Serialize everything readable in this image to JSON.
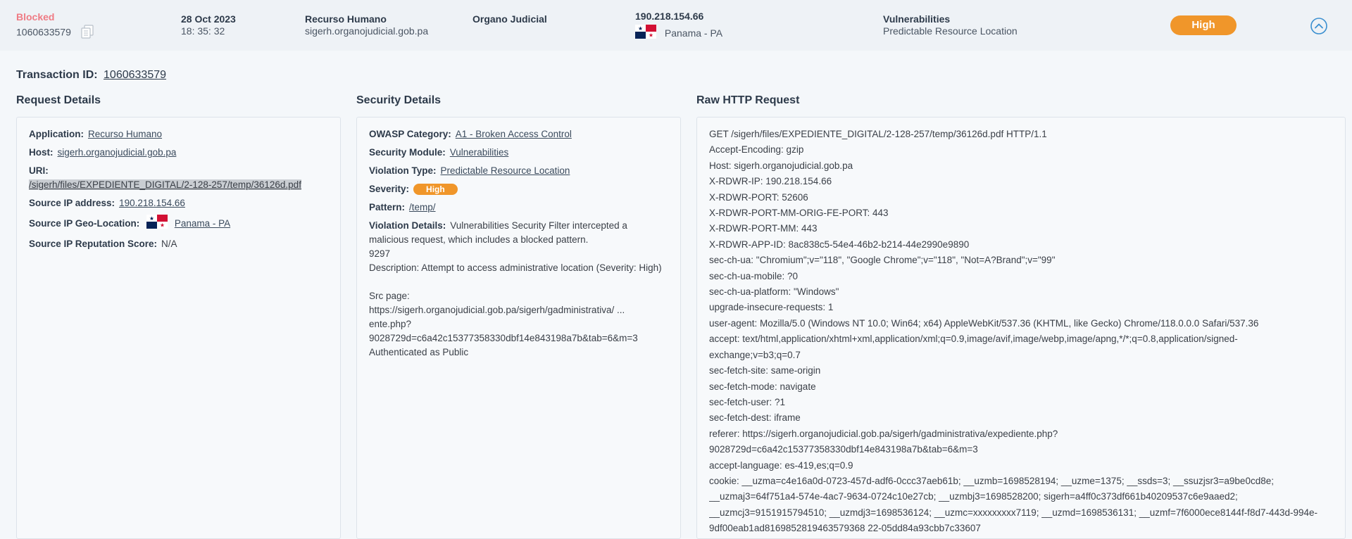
{
  "summary": {
    "status": "Blocked",
    "transaction_id": "1060633579",
    "date": "28 Oct 2023",
    "time": "18: 35: 32",
    "app_name": "Recurso Humano",
    "app_host": "sigerh.organojudicial.gob.pa",
    "organization": "Organo Judicial",
    "ip": "190.218.154.66",
    "geo": "Panama - PA",
    "module": "Vulnerabilities",
    "violation": "Predictable Resource Location",
    "severity": "High"
  },
  "transaction": {
    "label": "Transaction ID:",
    "id": "1060633579"
  },
  "request_details": {
    "title": "Request Details",
    "application_label": "Application:",
    "application": "Recurso Humano",
    "host_label": "Host:",
    "host": "sigerh.organojudicial.gob.pa",
    "uri_label": "URI:",
    "uri": "/sigerh/files/EXPEDIENTE_DIGITAL/2-128-257/temp/36126d.pdf",
    "source_ip_label": "Source IP address:",
    "source_ip": "190.218.154.66",
    "geo_label": "Source IP Geo-Location:",
    "geo": "Panama - PA",
    "reputation_label": "Source IP Reputation Score:",
    "reputation": "N/A"
  },
  "security_details": {
    "title": "Security Details",
    "owasp_label": "OWASP Category:",
    "owasp": "A1 - Broken Access Control",
    "module_label": "Security Module:",
    "module": "Vulnerabilities",
    "violation_label": "Violation Type:",
    "violation": "Predictable Resource Location",
    "severity_label": "Severity:",
    "severity": "High",
    "pattern_label": "Pattern:",
    "pattern": "/temp/",
    "details_label": "Violation Details:",
    "details_first": "Vulnerabilities Security Filter intercepted a malicious request, which includes a blocked pattern.",
    "details_rest": "9297\nDescription: Attempt to access administrative location (Severity: High)\n\nSrc page:\nhttps://sigerh.organojudicial.gob.pa/sigerh/gadministrativa/ ...\nente.php?\n9028729d=c6a42c15377358330dbf14e843198a7b&tab=6&m=3\nAuthenticated as Public"
  },
  "raw_http": {
    "title": "Raw HTTP Request",
    "lines": [
      "GET /sigerh/files/EXPEDIENTE_DIGITAL/2-128-257/temp/36126d.pdf HTTP/1.1",
      "Accept-Encoding: gzip",
      "Host: sigerh.organojudicial.gob.pa",
      "X-RDWR-IP: 190.218.154.66",
      "X-RDWR-PORT: 52606",
      "X-RDWR-PORT-MM-ORIG-FE-PORT: 443",
      "X-RDWR-PORT-MM: 443",
      "X-RDWR-APP-ID: 8ac838c5-54e4-46b2-b214-44e2990e9890",
      "sec-ch-ua: \"Chromium\";v=\"118\", \"Google Chrome\";v=\"118\", \"Not=A?Brand\";v=\"99\"",
      "sec-ch-ua-mobile: ?0",
      "sec-ch-ua-platform: \"Windows\"",
      "upgrade-insecure-requests: 1",
      "user-agent: Mozilla/5.0 (Windows NT 10.0; Win64; x64) AppleWebKit/537.36 (KHTML, like Gecko) Chrome/118.0.0.0 Safari/537.36",
      "accept: text/html,application/xhtml+xml,application/xml;q=0.9,image/avif,image/webp,image/apng,*/*;q=0.8,application/signed-",
      "exchange;v=b3;q=0.7",
      "sec-fetch-site: same-origin",
      "sec-fetch-mode: navigate",
      "sec-fetch-user: ?1",
      "sec-fetch-dest: iframe",
      "referer: https://sigerh.organojudicial.gob.pa/sigerh/gadministrativa/expediente.php?",
      "9028729d=c6a42c15377358330dbf14e843198a7b&tab=6&m=3",
      "accept-language: es-419,es;q=0.9",
      "cookie: __uzma=c4e16a0d-0723-457d-adf6-0ccc37aeb61b; __uzmb=1698528194; __uzme=1375; __ssds=3; __ssuzjsr3=a9be0cd8e;",
      "__uzmaj3=64f751a4-574e-4ac7-9634-0724c10e27cb; __uzmbj3=1698528200; sigerh=a4ff0c373df661b40209537c6e9aaed2;",
      "__uzmcj3=9151915794510; __uzmdj3=1698536124; __uzmc=xxxxxxxxx7119; __uzmd=1698536131; __uzmf=7f6000ece8144f-f8d7-443d-994e-",
      "9df00eab1ad8169852819463579368 22-05dd84a93cbb7c33607"
    ]
  },
  "colors": {
    "severity_high": "#f0962a",
    "blocked": "#ef7b84",
    "accent": "#3a8fd0"
  }
}
